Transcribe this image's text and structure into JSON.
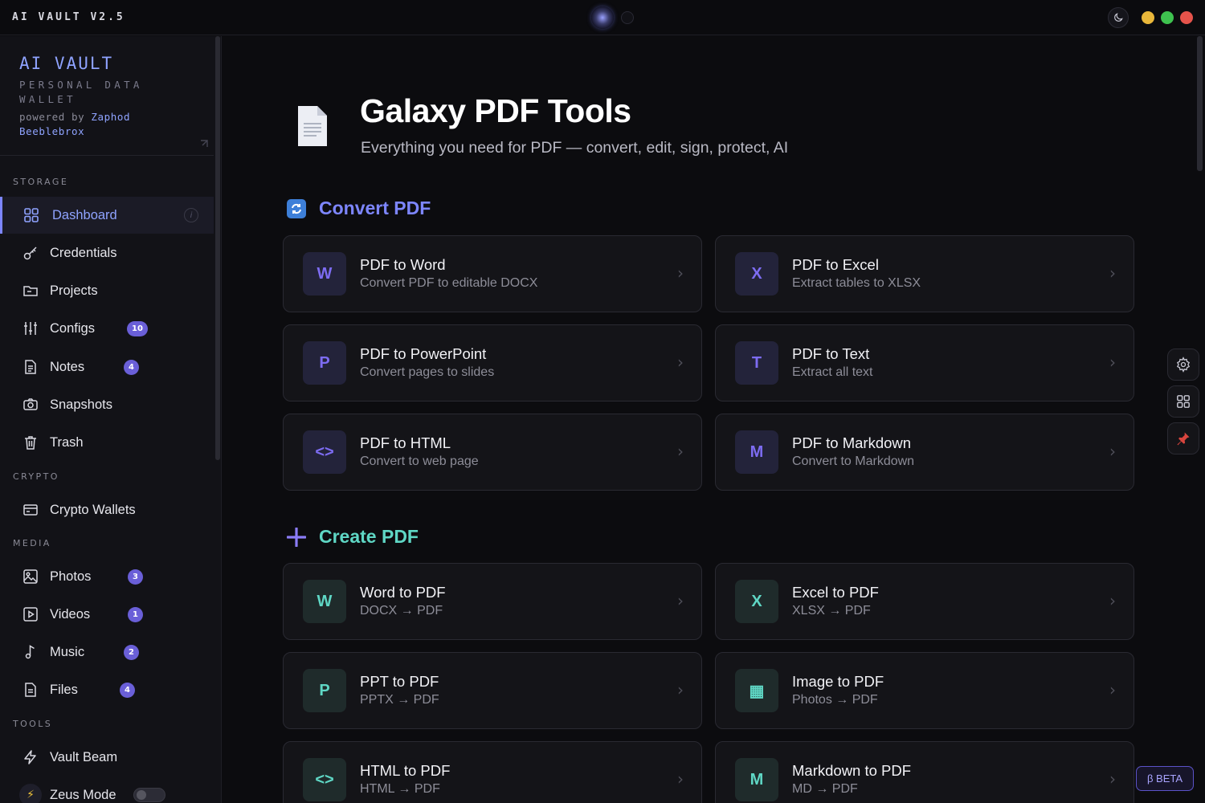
{
  "window": {
    "app_title": "AI VAULT V2.5"
  },
  "sidebar": {
    "brand": {
      "title": "AI VAULT",
      "subtitle_line1": "PERSONAL DATA",
      "subtitle_line2": "WALLET",
      "powered_prefix": "powered by",
      "author_first": "Zaphod",
      "author_last": "Beeblebrox"
    },
    "sections": {
      "storage": "STORAGE",
      "crypto": "CRYPTO",
      "media": "MEDIA",
      "tools": "TOOLS"
    },
    "items": [
      {
        "label": "Dashboard",
        "icon": "dashboard-icon",
        "active": true
      },
      {
        "label": "Credentials",
        "icon": "key-icon"
      },
      {
        "label": "Projects",
        "icon": "folder-icon"
      },
      {
        "label": "Configs",
        "icon": "sliders-icon",
        "badge": "10"
      },
      {
        "label": "Notes",
        "icon": "note-icon",
        "badge": "4"
      },
      {
        "label": "Snapshots",
        "icon": "camera-icon"
      },
      {
        "label": "Trash",
        "icon": "trash-icon"
      },
      {
        "label": "Crypto Wallets",
        "icon": "wallet-icon"
      },
      {
        "label": "Photos",
        "icon": "image-icon",
        "badge": "3"
      },
      {
        "label": "Videos",
        "icon": "video-icon",
        "badge": "1"
      },
      {
        "label": "Music",
        "icon": "music-icon",
        "badge": "2"
      },
      {
        "label": "Files",
        "icon": "file-icon",
        "badge": "4"
      },
      {
        "label": "Vault Beam",
        "icon": "bolt-icon"
      },
      {
        "label": "Zeus Mode",
        "icon": "zeus-avatar",
        "toggle": false
      }
    ]
  },
  "main": {
    "title": "Galaxy PDF Tools",
    "subtitle": "Everything you need for PDF — convert, edit, sign, protect, AI",
    "convert_section": {
      "title": "Convert PDF",
      "color": "#7d86ff",
      "cards": [
        {
          "letter": "W",
          "title": "PDF to Word",
          "desc": "Convert PDF to editable DOCX"
        },
        {
          "letter": "X",
          "title": "PDF to Excel",
          "desc": "Extract tables to XLSX"
        },
        {
          "letter": "P",
          "title": "PDF to PowerPoint",
          "desc": "Convert pages to slides"
        },
        {
          "letter": "T",
          "title": "PDF to Text",
          "desc": "Extract all text"
        },
        {
          "letter": "<>",
          "title": "PDF to HTML",
          "desc": "Convert to web page"
        },
        {
          "letter": "M",
          "title": "PDF to Markdown",
          "desc": "Convert to Markdown"
        }
      ]
    },
    "create_section": {
      "title": "Create PDF",
      "color": "#5fd7c5",
      "cards": [
        {
          "letter": "W",
          "title": "Word to PDF",
          "desc": "DOCX → PDF"
        },
        {
          "letter": "X",
          "title": "Excel to PDF",
          "desc": "XLSX → PDF"
        },
        {
          "letter": "P",
          "title": "PPT to PDF",
          "desc": "PPTX → PDF"
        },
        {
          "letter": "▦",
          "title": "Image to PDF",
          "desc": "Photos → PDF"
        },
        {
          "letter": "<>",
          "title": "HTML to PDF",
          "desc": "HTML → PDF"
        },
        {
          "letter": "M",
          "title": "Markdown to PDF",
          "desc": "MD → PDF"
        }
      ]
    }
  },
  "floating": {
    "beta_label": "β BETA"
  },
  "colors": {
    "accent": "#7d86ff",
    "badge": "#6a5fd8",
    "create_accent": "#5fd7c5"
  }
}
